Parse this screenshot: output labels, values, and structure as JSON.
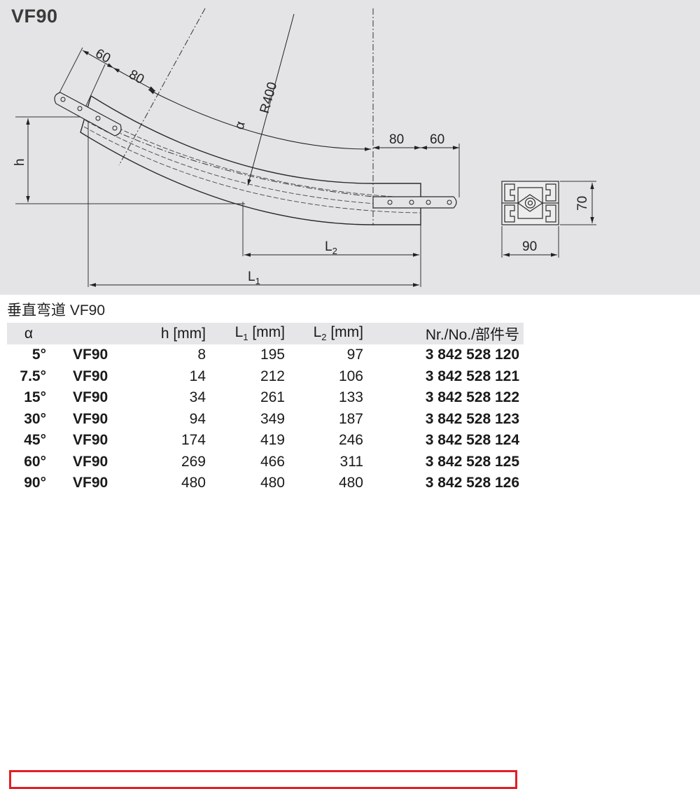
{
  "drawing": {
    "title": "VF90",
    "dims": {
      "top_60": "60",
      "top_80": "80",
      "radius": "R400",
      "alpha": "α",
      "right_80": "80",
      "right_60": "60",
      "h": "h",
      "l2": "L",
      "l2_sub": "2",
      "l1": "L",
      "l1_sub": "1",
      "section_height": "70",
      "section_width": "90"
    }
  },
  "table": {
    "caption": "垂直弯道 VF90",
    "headers": {
      "alpha": "α",
      "h": "h [mm]",
      "l1_main": "L",
      "l1_sub": "1",
      "l1_unit": " [mm]",
      "l2_main": "L",
      "l2_sub": "2",
      "l2_unit": " [mm]",
      "nr": "Nr./No./部件号"
    },
    "rows": [
      {
        "alpha": "5°",
        "type": "VF90",
        "h": "8",
        "l1": "195",
        "l2": "97",
        "nr": "3 842 528 120"
      },
      {
        "alpha": "7.5°",
        "type": "VF90",
        "h": "14",
        "l1": "212",
        "l2": "106",
        "nr": "3 842 528 121"
      },
      {
        "alpha": "15°",
        "type": "VF90",
        "h": "34",
        "l1": "261",
        "l2": "133",
        "nr": "3 842 528 122"
      },
      {
        "alpha": "30°",
        "type": "VF90",
        "h": "94",
        "l1": "349",
        "l2": "187",
        "nr": "3 842 528 123"
      },
      {
        "alpha": "45°",
        "type": "VF90",
        "h": "174",
        "l1": "419",
        "l2": "246",
        "nr": "3 842 528 124"
      },
      {
        "alpha": "60°",
        "type": "VF90",
        "h": "269",
        "l1": "466",
        "l2": "311",
        "nr": "3 842 528 125"
      },
      {
        "alpha": "90°",
        "type": "VF90",
        "h": "480",
        "l1": "480",
        "l2": "480",
        "nr": "3 842 528 126"
      }
    ],
    "highlight_color": "#e31e24"
  }
}
